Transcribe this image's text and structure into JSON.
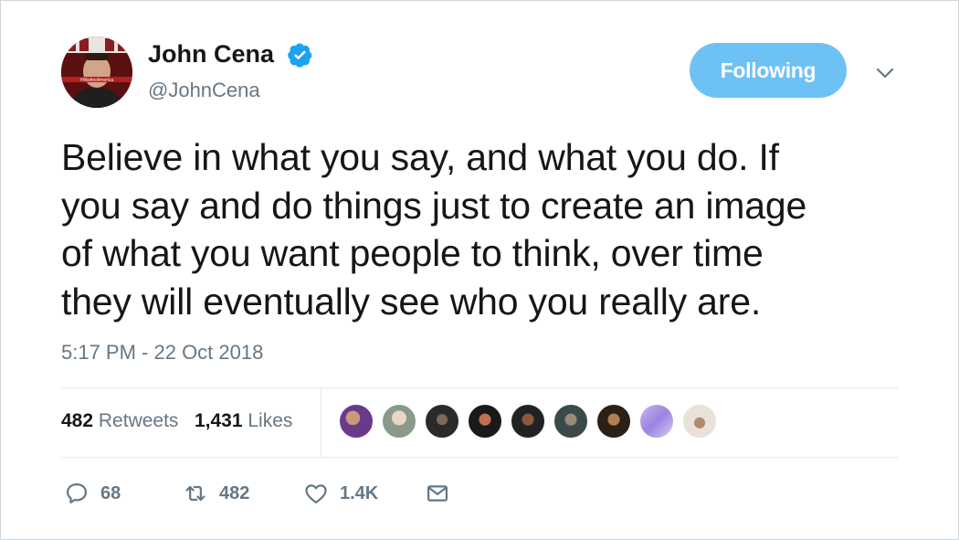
{
  "user": {
    "name": "John Cena",
    "handle": "@JohnCena",
    "verified": true,
    "avatar_caption": "#WeAreAmerica"
  },
  "follow_button": {
    "label": "Following",
    "color": "#6ec1f5"
  },
  "tweet": {
    "lines": [
      "Believe in what you say, and what you do. If",
      "you say and do things just to create an image",
      "of what you want people to think, over time",
      "they will eventually see who you really are."
    ],
    "timestamp": "5:17 PM - 22 Oct 2018"
  },
  "stats": {
    "retweets_count": "482",
    "retweets_label": "Retweets",
    "likes_count": "1,431",
    "likes_label": "Likes"
  },
  "likers_count_shown": 9,
  "actions": {
    "reply_count": "68",
    "retweet_count": "482",
    "like_count": "1.4K"
  },
  "colors": {
    "text_primary": "#14171a",
    "text_secondary": "#657786",
    "divider": "#e1e8ed",
    "verified_blue": "#1da1f2"
  }
}
